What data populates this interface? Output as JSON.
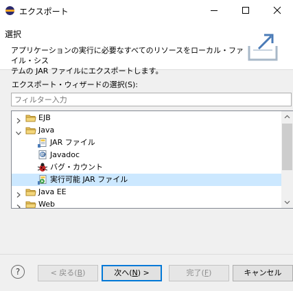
{
  "window": {
    "title": "エクスポート"
  },
  "header": {
    "title": "選択",
    "description_line1": "アプリケーションの実行に必要なすべてのリソースをローカル・ファイル・シス",
    "description_line2": "テムの JAR ファイルにエクスポートします。"
  },
  "wizard_list": {
    "label": "エクスポート・ウィザードの選択(S):",
    "filter_placeholder": "フィルター入力",
    "items": [
      {
        "label": "EJB",
        "icon": "folder-icon",
        "level": 0,
        "expanded": false,
        "selected": false
      },
      {
        "label": "Java",
        "icon": "folder-icon",
        "level": 0,
        "expanded": true,
        "selected": false
      },
      {
        "label": "JAR ファイル",
        "icon": "jar-file-icon",
        "level": 1,
        "selected": false
      },
      {
        "label": "Javadoc",
        "icon": "javadoc-icon",
        "level": 1,
        "selected": false
      },
      {
        "label": "バグ・カウント",
        "icon": "bug-icon",
        "level": 1,
        "selected": false
      },
      {
        "label": "実行可能 JAR ファイル",
        "icon": "runnable-jar-icon",
        "level": 1,
        "selected": true
      },
      {
        "label": "Java EE",
        "icon": "folder-icon",
        "level": 0,
        "expanded": false,
        "selected": false
      },
      {
        "label": "Web",
        "icon": "folder-icon",
        "level": 0,
        "expanded": false,
        "selected": false
      }
    ]
  },
  "buttons": {
    "help": "?",
    "back": {
      "text": "< 戻る(",
      "key": "B",
      "suffix": ")",
      "enabled": false
    },
    "next": {
      "text": "次へ(",
      "key": "N",
      "suffix": ") >",
      "enabled": true
    },
    "finish": {
      "text": "完了(",
      "key": "F",
      "suffix": ")",
      "enabled": false
    },
    "cancel": {
      "text": "キャンセル",
      "enabled": true
    }
  },
  "colors": {
    "selection": "#cce8ff",
    "folder": "#e8c15f",
    "default_button_border": "#0078d7"
  }
}
